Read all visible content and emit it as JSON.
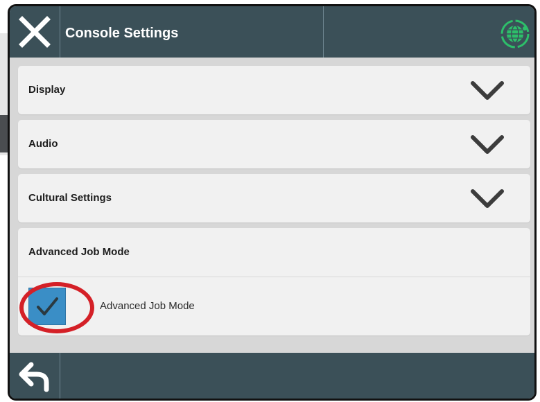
{
  "header": {
    "title": "Console Settings",
    "close_icon": "close-icon",
    "globe_icon": "globe-icon"
  },
  "sections": [
    {
      "label": "Display",
      "expanded": false,
      "icon": "chevron-down-icon"
    },
    {
      "label": "Audio",
      "expanded": false,
      "icon": "chevron-down-icon"
    },
    {
      "label": "Cultural Settings",
      "expanded": false,
      "icon": "chevron-down-icon"
    },
    {
      "label": "Advanced Job Mode",
      "expanded": true,
      "option": {
        "label": "Advanced Job Mode",
        "checked": true
      }
    }
  ],
  "footer": {
    "back_icon": "back-arrow-icon"
  },
  "colors": {
    "bar": "#3b5058",
    "checkbox": "#3a8ec6",
    "highlight": "#d42027",
    "globe_accent": "#2dbf6a"
  }
}
